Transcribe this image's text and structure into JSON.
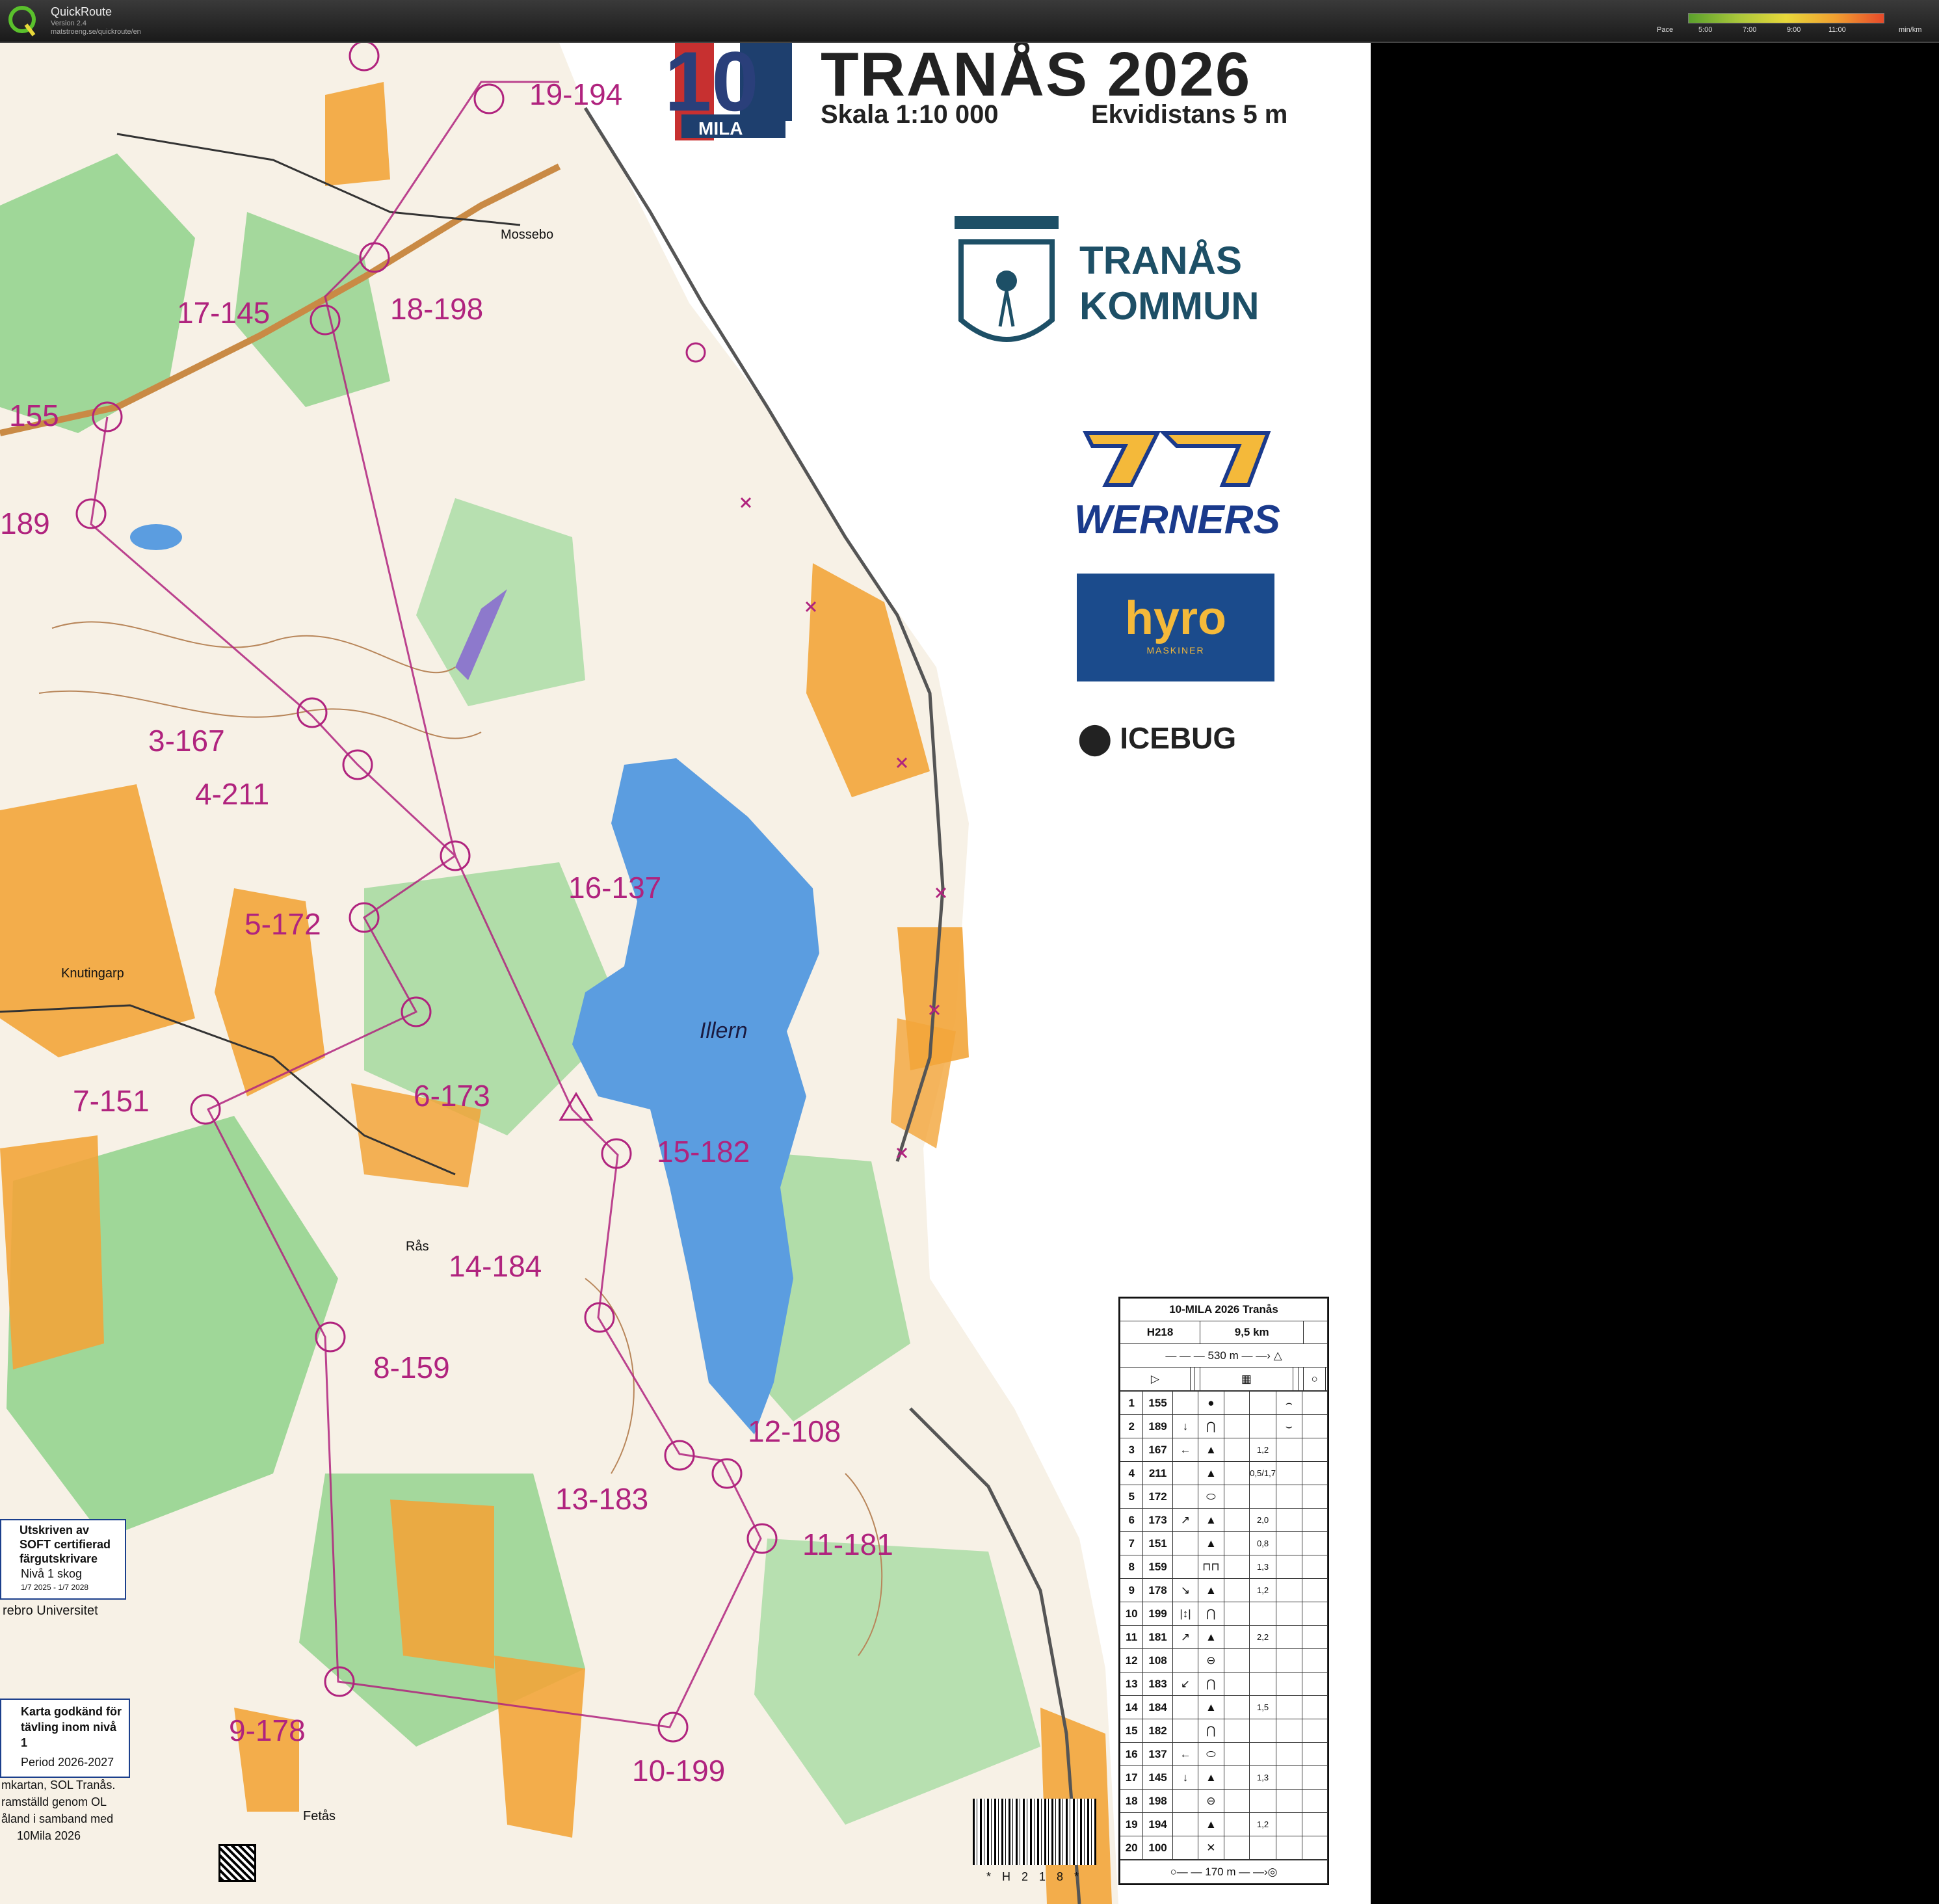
{
  "app": {
    "name": "QuickRoute",
    "version": "Version 2.4",
    "url": "matstroeng.se/quickroute/en"
  },
  "pace_legend": {
    "label": "Pace",
    "ticks": [
      "5:00",
      "7:00",
      "9:00",
      "11:00"
    ],
    "unit": "min/km"
  },
  "map_header": {
    "title": "TRANÅS 2026",
    "scale": "Skala 1:10 000",
    "equidistance": "Ekvidistans 5 m",
    "event_logo_number": "10",
    "event_logo_text": "MILA"
  },
  "sponsors": {
    "tranas": [
      "TRANÅS",
      "KOMMUN"
    ],
    "werners": "WERNERS",
    "hyro": "hyro",
    "hyro_sub": "MASKINER",
    "icebug": "ICEBUG"
  },
  "controls": [
    {
      "label": "19-194"
    },
    {
      "label": "17-145"
    },
    {
      "label": "18-198"
    },
    {
      "label": "155"
    },
    {
      "label": "189"
    },
    {
      "label": "3-167"
    },
    {
      "label": "4-211"
    },
    {
      "label": "16-137"
    },
    {
      "label": "5-172"
    },
    {
      "label": "7-151"
    },
    {
      "label": "6-173"
    },
    {
      "label": "15-182"
    },
    {
      "label": "14-184"
    },
    {
      "label": "8-159"
    },
    {
      "label": "12-108"
    },
    {
      "label": "13-183"
    },
    {
      "label": "11-181"
    },
    {
      "label": "9-178"
    },
    {
      "label": "10-199"
    }
  ],
  "places": {
    "mossebo": "Mossebo",
    "knutingarp": "Knutingarp",
    "ras": "Rås",
    "fetas": "Fetås",
    "lake": "Illern"
  },
  "description_sheet": {
    "title": "10-MILA 2026 Tranås",
    "class": "H218",
    "length": "9,5 km",
    "start_leg": "530 m",
    "finish_leg": "170 m",
    "rows": [
      {
        "n": "1",
        "code": "155",
        "dir": "",
        "feat": "●",
        "dim": "",
        "loc": "⌢"
      },
      {
        "n": "2",
        "code": "189",
        "dir": "↓",
        "feat": "⋂",
        "dim": "",
        "loc": "⌣"
      },
      {
        "n": "3",
        "code": "167",
        "dir": "←",
        "feat": "▲",
        "dim": "1,2",
        "loc": ""
      },
      {
        "n": "4",
        "code": "211",
        "dir": "",
        "feat": "▲",
        "dim": "0,5/1,7",
        "loc": ""
      },
      {
        "n": "5",
        "code": "172",
        "dir": "",
        "feat": "⬭",
        "dim": "",
        "loc": ""
      },
      {
        "n": "6",
        "code": "173",
        "dir": "↗",
        "feat": "▲",
        "dim": "2,0",
        "loc": ""
      },
      {
        "n": "7",
        "code": "151",
        "dir": "",
        "feat": "▲",
        "dim": "0,8",
        "loc": ""
      },
      {
        "n": "8",
        "code": "159",
        "dir": "",
        "feat": "⊓⊓",
        "dim": "1,3",
        "loc": ""
      },
      {
        "n": "9",
        "code": "178",
        "dir": "↘",
        "feat": "▲",
        "dim": "1,2",
        "loc": ""
      },
      {
        "n": "10",
        "code": "199",
        "dir": "|↕|",
        "feat": "⋂",
        "dim": "",
        "loc": ""
      },
      {
        "n": "11",
        "code": "181",
        "dir": "↗",
        "feat": "▲",
        "dim": "2,2",
        "loc": ""
      },
      {
        "n": "12",
        "code": "108",
        "dir": "",
        "feat": "⊖",
        "dim": "",
        "loc": ""
      },
      {
        "n": "13",
        "code": "183",
        "dir": "↙",
        "feat": "⋂",
        "dim": "",
        "loc": ""
      },
      {
        "n": "14",
        "code": "184",
        "dir": "",
        "feat": "▲",
        "dim": "1,5",
        "loc": ""
      },
      {
        "n": "15",
        "code": "182",
        "dir": "",
        "feat": "⋂",
        "dim": "",
        "loc": ""
      },
      {
        "n": "16",
        "code": "137",
        "dir": "←",
        "feat": "⬭",
        "dim": "",
        "loc": ""
      },
      {
        "n": "17",
        "code": "145",
        "dir": "↓",
        "feat": "▲",
        "dim": "1,3",
        "loc": ""
      },
      {
        "n": "18",
        "code": "198",
        "dir": "",
        "feat": "⊖",
        "dim": "",
        "loc": ""
      },
      {
        "n": "19",
        "code": "194",
        "dir": "",
        "feat": "▲",
        "dim": "1,2",
        "loc": ""
      },
      {
        "n": "20",
        "code": "100",
        "dir": "",
        "feat": "✕",
        "dim": "",
        "loc": ""
      }
    ]
  },
  "notes": {
    "soft_title": "Utskriven av SOFT certifierad färgutskrivare",
    "soft_level": "Nivå 1 skog",
    "soft_period": "1/7 2025 - 1/7 2028",
    "university": "rebro Universitet",
    "approved_title": "Karta godkänd för tävling inom nivå 1",
    "approved_period": "Period 2026-2027",
    "credits": [
      "mkartan, SOL Tranås.",
      "ramställd genom OL",
      "åland i samband med",
      "10Mila 2026"
    ]
  },
  "barcode_text": "* H 2 1 8 *",
  "colors": {
    "course": "#b0237e",
    "forest_green": "#6cc36a",
    "open_yellow": "#f2a53a",
    "water_blue": "#5b9de0",
    "route_purple": "#a4347e"
  }
}
